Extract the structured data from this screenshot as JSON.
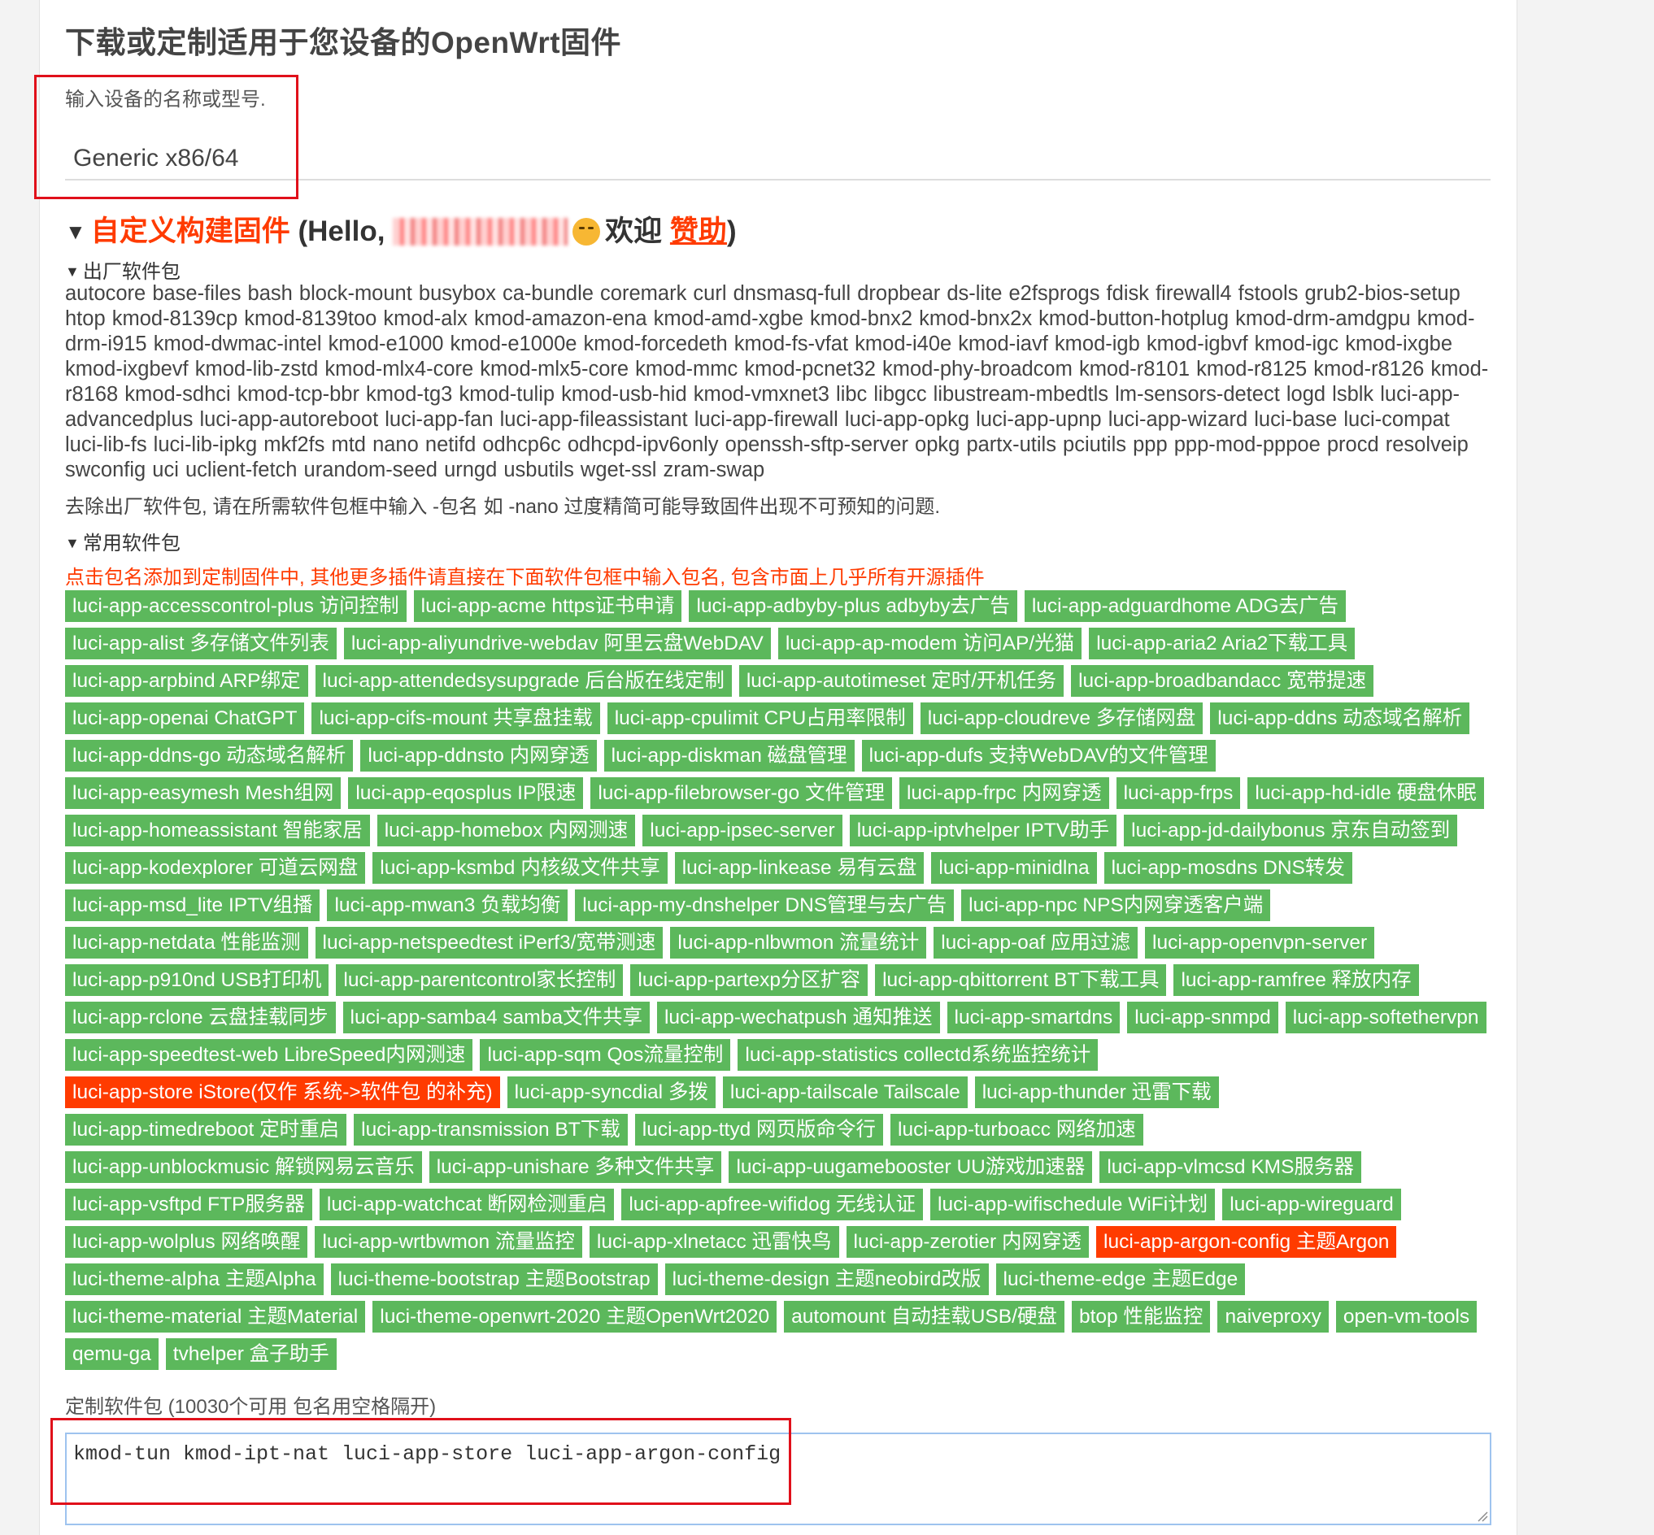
{
  "page": {
    "title": "下载或定制适用于您设备的OpenWrt固件",
    "device_label": "输入设备的名称或型号.",
    "device_value": "Generic x86/64"
  },
  "custom_build": {
    "heading": "自定义构建固件",
    "hello_prefix": "(Hello,",
    "welcome": "欢迎",
    "sponsor": "赞助",
    "close_paren": ")"
  },
  "default_packages": {
    "label": "出厂软件包",
    "list": "autocore base-files bash block-mount busybox ca-bundle coremark curl dnsmasq-full dropbear ds-lite e2fsprogs fdisk firewall4 fstools grub2-bios-setup htop kmod-8139cp kmod-8139too kmod-alx kmod-amazon-ena kmod-amd-xgbe kmod-bnx2 kmod-bnx2x kmod-button-hotplug kmod-drm-amdgpu kmod-drm-i915 kmod-dwmac-intel kmod-e1000 kmod-e1000e kmod-forcedeth kmod-fs-vfat kmod-i40e kmod-iavf kmod-igb kmod-igbvf kmod-igc kmod-ixgbe kmod-ixgbevf kmod-lib-zstd kmod-mlx4-core kmod-mlx5-core kmod-mmc kmod-pcnet32 kmod-phy-broadcom kmod-r8101 kmod-r8125 kmod-r8126 kmod-r8168 kmod-sdhci kmod-tcp-bbr kmod-tg3 kmod-tulip kmod-usb-hid kmod-vmxnet3 libc libgcc libustream-mbedtls lm-sensors-detect logd lsblk luci-app-advancedplus luci-app-autoreboot luci-app-fan luci-app-fileassistant luci-app-firewall luci-app-opkg luci-app-upnp luci-app-wizard luci-base luci-compat luci-lib-fs luci-lib-ipkg mkf2fs mtd nano netifd odhcp6c odhcpd-ipv6only openssh-sftp-server opkg partx-utils pciutils ppp ppp-mod-pppoe procd resolveip swconfig uci uclient-fetch urandom-seed urngd usbutils wget-ssl zram-swap",
    "hint": "去除出厂软件包, 请在所需软件包框中输入 -包名 如 -nano 过度精简可能导致固件出现不可预知的问题."
  },
  "common_packages": {
    "label": "常用软件包",
    "note": "点击包名添加到定制固件中, 其他更多插件请直接在下面软件包框中输入包名, 包含市面上几乎所有开源插件",
    "items": [
      {
        "label": "luci-app-accesscontrol-plus 访问控制",
        "selected": false
      },
      {
        "label": "luci-app-acme https证书申请",
        "selected": false
      },
      {
        "label": "luci-app-adbyby-plus adbyby去广告",
        "selected": false
      },
      {
        "label": "luci-app-adguardhome ADG去广告",
        "selected": false
      },
      {
        "label": "luci-app-alist 多存储文件列表",
        "selected": false
      },
      {
        "label": "luci-app-aliyundrive-webdav 阿里云盘WebDAV",
        "selected": false
      },
      {
        "label": "luci-app-ap-modem 访问AP/光猫",
        "selected": false
      },
      {
        "label": "luci-app-aria2 Aria2下载工具",
        "selected": false
      },
      {
        "label": "luci-app-arpbind ARP绑定",
        "selected": false
      },
      {
        "label": "luci-app-attendedsysupgrade 后台版在线定制",
        "selected": false
      },
      {
        "label": "luci-app-autotimeset 定时/开机任务",
        "selected": false
      },
      {
        "label": "luci-app-broadbandacc 宽带提速",
        "selected": false
      },
      {
        "label": "luci-app-openai ChatGPT",
        "selected": false
      },
      {
        "label": "luci-app-cifs-mount 共享盘挂载",
        "selected": false
      },
      {
        "label": "luci-app-cpulimit CPU占用率限制",
        "selected": false
      },
      {
        "label": "luci-app-cloudreve 多存储网盘",
        "selected": false
      },
      {
        "label": "luci-app-ddns 动态域名解析",
        "selected": false
      },
      {
        "label": "luci-app-ddns-go 动态域名解析",
        "selected": false
      },
      {
        "label": "luci-app-ddnsto 内网穿透",
        "selected": false
      },
      {
        "label": "luci-app-diskman 磁盘管理",
        "selected": false
      },
      {
        "label": "luci-app-dufs 支持WebDAV的文件管理",
        "selected": false
      },
      {
        "label": "luci-app-easymesh Mesh组网",
        "selected": false
      },
      {
        "label": "luci-app-eqosplus IP限速",
        "selected": false
      },
      {
        "label": "luci-app-filebrowser-go 文件管理",
        "selected": false
      },
      {
        "label": "luci-app-frpc 内网穿透",
        "selected": false
      },
      {
        "label": "luci-app-frps",
        "selected": false
      },
      {
        "label": "luci-app-hd-idle 硬盘休眠",
        "selected": false
      },
      {
        "label": "luci-app-homeassistant 智能家居",
        "selected": false
      },
      {
        "label": "luci-app-homebox 内网测速",
        "selected": false
      },
      {
        "label": "luci-app-ipsec-server",
        "selected": false
      },
      {
        "label": "luci-app-iptvhelper IPTV助手",
        "selected": false
      },
      {
        "label": "luci-app-jd-dailybonus 京东自动签到",
        "selected": false
      },
      {
        "label": "luci-app-kodexplorer 可道云网盘",
        "selected": false
      },
      {
        "label": "luci-app-ksmbd 内核级文件共享",
        "selected": false
      },
      {
        "label": "luci-app-linkease 易有云盘",
        "selected": false
      },
      {
        "label": "luci-app-minidlna",
        "selected": false
      },
      {
        "label": "luci-app-mosdns DNS转发",
        "selected": false
      },
      {
        "label": "luci-app-msd_lite IPTV组播",
        "selected": false
      },
      {
        "label": "luci-app-mwan3 负载均衡",
        "selected": false
      },
      {
        "label": "luci-app-my-dnshelper DNS管理与去广告",
        "selected": false
      },
      {
        "label": "luci-app-npc NPS内网穿透客户端",
        "selected": false
      },
      {
        "label": "luci-app-netdata 性能监测",
        "selected": false
      },
      {
        "label": "luci-app-netspeedtest iPerf3/宽带测速",
        "selected": false
      },
      {
        "label": "luci-app-nlbwmon 流量统计",
        "selected": false
      },
      {
        "label": "luci-app-oaf 应用过滤",
        "selected": false
      },
      {
        "label": "luci-app-openvpn-server",
        "selected": false
      },
      {
        "label": "luci-app-p910nd USB打印机",
        "selected": false
      },
      {
        "label": "luci-app-parentcontrol家长控制",
        "selected": false
      },
      {
        "label": "luci-app-partexp分区扩容",
        "selected": false
      },
      {
        "label": "luci-app-qbittorrent BT下载工具",
        "selected": false
      },
      {
        "label": "luci-app-ramfree 释放内存",
        "selected": false
      },
      {
        "label": "luci-app-rclone 云盘挂载同步",
        "selected": false
      },
      {
        "label": "luci-app-samba4 samba文件共享",
        "selected": false
      },
      {
        "label": "luci-app-wechatpush 通知推送",
        "selected": false
      },
      {
        "label": "luci-app-smartdns",
        "selected": false
      },
      {
        "label": "luci-app-snmpd",
        "selected": false
      },
      {
        "label": "luci-app-softethervpn",
        "selected": false
      },
      {
        "label": "luci-app-speedtest-web LibreSpeed内网测速",
        "selected": false
      },
      {
        "label": "luci-app-sqm Qos流量控制",
        "selected": false
      },
      {
        "label": "luci-app-statistics collectd系统监控统计",
        "selected": false
      },
      {
        "label": "luci-app-store iStore(仅作 系统->软件包 的补充)",
        "selected": true
      },
      {
        "label": "luci-app-syncdial 多拨",
        "selected": false
      },
      {
        "label": "luci-app-tailscale Tailscale",
        "selected": false
      },
      {
        "label": "luci-app-thunder 迅雷下载",
        "selected": false
      },
      {
        "label": "luci-app-timedreboot 定时重启",
        "selected": false
      },
      {
        "label": "luci-app-transmission BT下载",
        "selected": false
      },
      {
        "label": "luci-app-ttyd 网页版命令行",
        "selected": false
      },
      {
        "label": "luci-app-turboacc 网络加速",
        "selected": false
      },
      {
        "label": "luci-app-unblockmusic 解锁网易云音乐",
        "selected": false
      },
      {
        "label": "luci-app-unishare 多种文件共享",
        "selected": false
      },
      {
        "label": "luci-app-uugamebooster UU游戏加速器",
        "selected": false
      },
      {
        "label": "luci-app-vlmcsd KMS服务器",
        "selected": false
      },
      {
        "label": "luci-app-vsftpd FTP服务器",
        "selected": false
      },
      {
        "label": "luci-app-watchcat 断网检测重启",
        "selected": false
      },
      {
        "label": "luci-app-apfree-wifidog 无线认证",
        "selected": false
      },
      {
        "label": "luci-app-wifischedule WiFi计划",
        "selected": false
      },
      {
        "label": "luci-app-wireguard",
        "selected": false
      },
      {
        "label": "luci-app-wolplus 网络唤醒",
        "selected": false
      },
      {
        "label": "luci-app-wrtbwmon 流量监控",
        "selected": false
      },
      {
        "label": "luci-app-xlnetacc 迅雷快鸟",
        "selected": false
      },
      {
        "label": "luci-app-zerotier 内网穿透",
        "selected": false
      },
      {
        "label": "luci-app-argon-config 主题Argon",
        "selected": true
      },
      {
        "label": "luci-theme-alpha 主题Alpha",
        "selected": false
      },
      {
        "label": "luci-theme-bootstrap 主题Bootstrap",
        "selected": false
      },
      {
        "label": "luci-theme-design 主题neobird改版",
        "selected": false
      },
      {
        "label": "luci-theme-edge 主题Edge",
        "selected": false
      },
      {
        "label": "luci-theme-material 主题Material",
        "selected": false
      },
      {
        "label": "luci-theme-openwrt-2020 主题OpenWrt2020",
        "selected": false
      },
      {
        "label": "automount 自动挂载USB/硬盘",
        "selected": false
      },
      {
        "label": "btop 性能监控",
        "selected": false
      },
      {
        "label": "naiveproxy",
        "selected": false
      },
      {
        "label": "open-vm-tools",
        "selected": false
      },
      {
        "label": "qemu-ga",
        "selected": false
      },
      {
        "label": "tvhelper 盒子助手",
        "selected": false
      }
    ]
  },
  "custom_packages": {
    "label": "定制软件包 (10030个可用 包名用空格隔开)",
    "value": "kmod-tun kmod-ipt-nat luci-app-store luci-app-argon-config"
  },
  "colors": {
    "accent_orange": "#ff3b00",
    "package_green": "#5cb85c",
    "highlight_red_box": "#e0101a"
  }
}
